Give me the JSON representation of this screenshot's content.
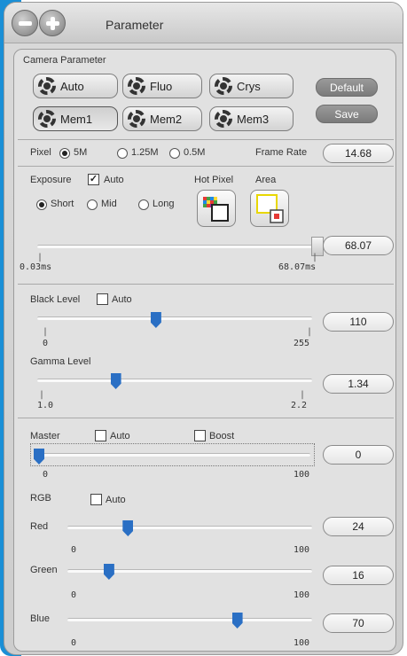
{
  "window": {
    "title": "Parameter"
  },
  "camera": {
    "section_label": "Camera Parameter",
    "buttons": [
      "Auto",
      "Fluo",
      "Crys",
      "Mem1",
      "Mem2",
      "Mem3"
    ],
    "default_label": "Default",
    "save_label": "Save"
  },
  "pixel": {
    "label": "Pixel",
    "options": [
      "5M",
      "1.25M",
      "0.5M"
    ],
    "selected": "5M",
    "frame_rate_label": "Frame Rate",
    "frame_rate_value": "14.68"
  },
  "exposure": {
    "label": "Exposure",
    "auto_label": "Auto",
    "auto_checked": true,
    "options": [
      "Short",
      "Mid",
      "Long"
    ],
    "selected": "Short",
    "hot_pixel_label": "Hot Pixel",
    "area_label": "Area",
    "value": "68.07",
    "min_label": "0.03ms",
    "max_label": "68.07ms",
    "fraction": 1.0
  },
  "black_level": {
    "label": "Black Level",
    "auto_label": "Auto",
    "value": "110",
    "min": "0",
    "max": "255",
    "fraction": 0.431
  },
  "gamma_level": {
    "label": "Gamma Level",
    "value": "1.34",
    "min": "1.0",
    "max": "2.2",
    "fraction": 0.283
  },
  "master": {
    "label": "Master",
    "auto_label": "Auto",
    "boost_label": "Boost",
    "value": "0",
    "min": "0",
    "max": "100",
    "fraction": 0.0
  },
  "rgb": {
    "label": "RGB",
    "auto_label": "Auto",
    "channels": [
      {
        "label": "Red",
        "value": "24",
        "min": "0",
        "max": "100",
        "fraction": 0.24
      },
      {
        "label": "Green",
        "value": "16",
        "min": "0",
        "max": "100",
        "fraction": 0.16
      },
      {
        "label": "Blue",
        "value": "70",
        "min": "0",
        "max": "100",
        "fraction": 0.7
      }
    ]
  },
  "colors": {
    "accent_blue": "#2a6fc4",
    "side_bar": "#1a8fd6"
  }
}
